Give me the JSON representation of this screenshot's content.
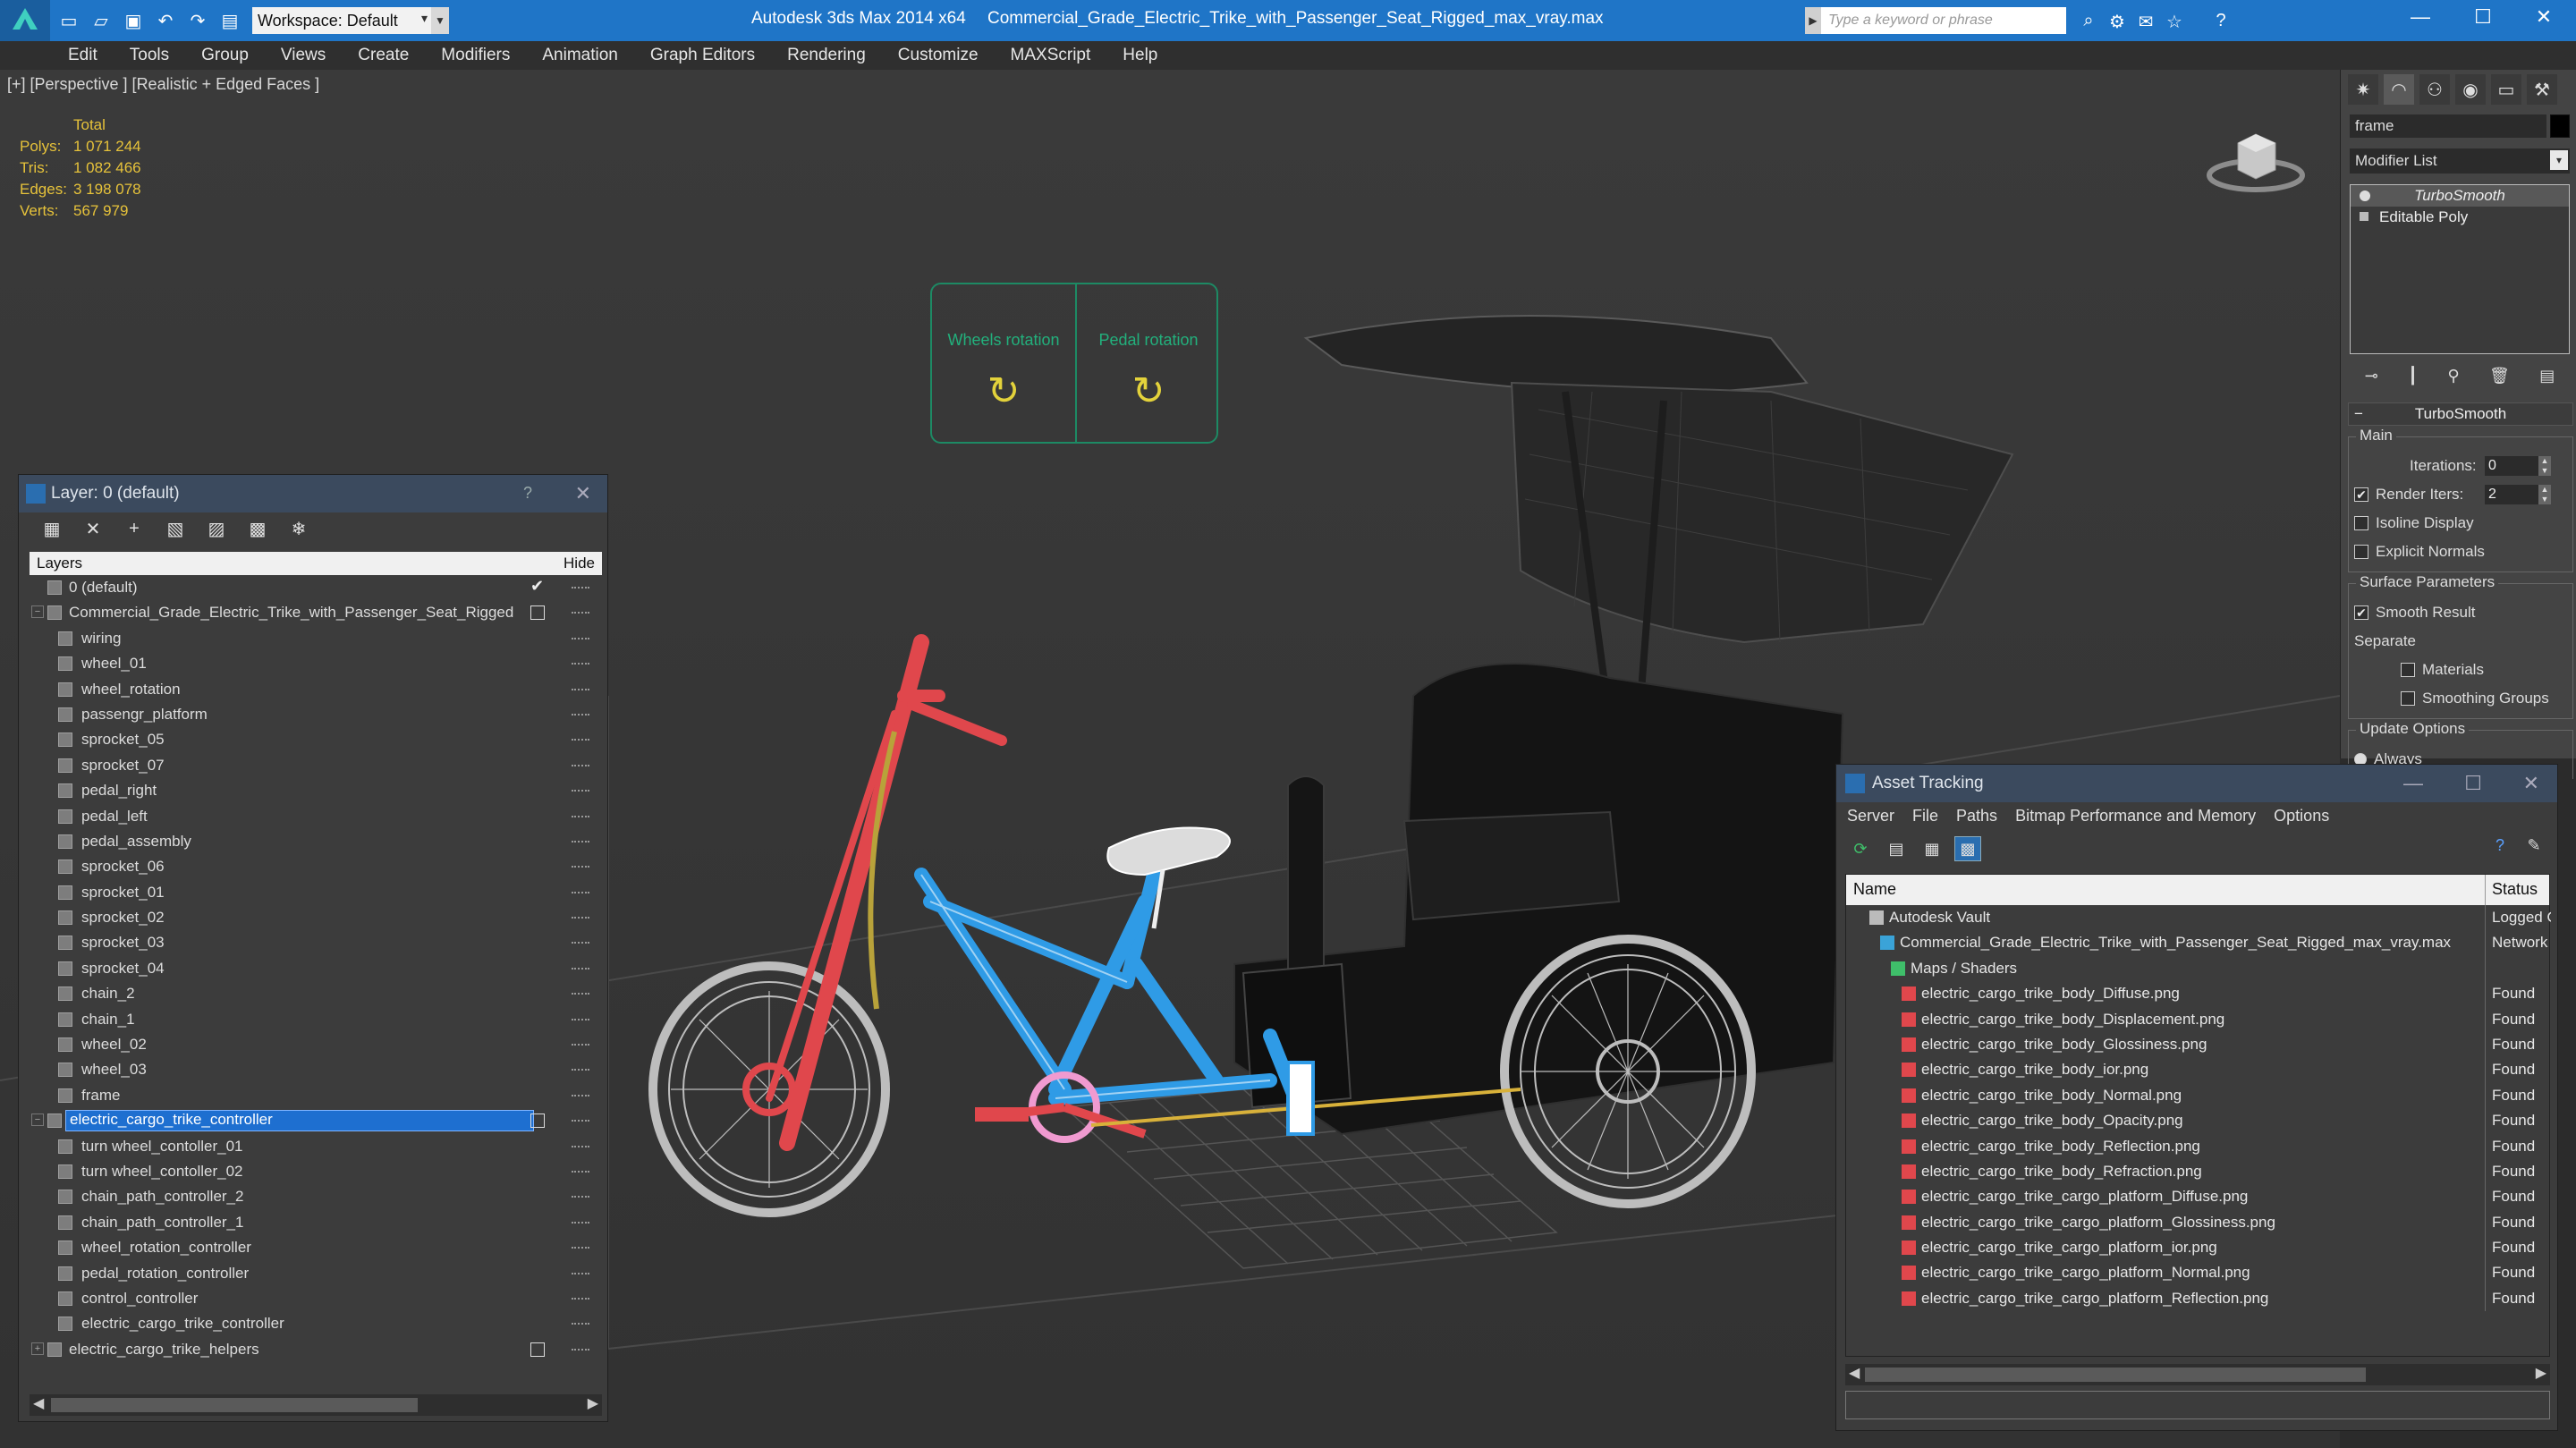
{
  "titlebar": {
    "workspace_label": "Workspace: Default",
    "app_title": "Autodesk 3ds Max  2014 x64",
    "file_title": "Commercial_Grade_Electric_Trike_with_Passenger_Seat_Rigged_max_vray.max",
    "search_placeholder": "Type a keyword or phrase"
  },
  "menubar": [
    "Edit",
    "Tools",
    "Group",
    "Views",
    "Create",
    "Modifiers",
    "Animation",
    "Graph Editors",
    "Rendering",
    "Customize",
    "MAXScript",
    "Help"
  ],
  "viewport": {
    "label": "[+] [Perspective ] [Realistic + Edged Faces ]",
    "stats": {
      "header": "Total",
      "rows": [
        {
          "key": "Polys:",
          "value": "1 071 244"
        },
        {
          "key": "Tris:",
          "value": "1 082 466"
        },
        {
          "key": "Edges:",
          "value": "3 198 078"
        },
        {
          "key": "Verts:",
          "value": "567 979"
        }
      ]
    },
    "rotation_panel": {
      "wheels_label": "Wheels rotation",
      "pedal_label": "Pedal rotation"
    }
  },
  "layer_panel": {
    "title": "Layer: 0 (default)",
    "help": "?",
    "header_layers": "Layers",
    "header_hide": "Hide",
    "rows": [
      {
        "name": "0 (default)",
        "level": 0,
        "type": "layer",
        "current": true
      },
      {
        "name": "Commercial_Grade_Electric_Trike_with_Passenger_Seat_Rigged",
        "level": 0,
        "type": "layer",
        "expand": "−",
        "box": true
      },
      {
        "name": "wiring",
        "level": 1,
        "type": "object"
      },
      {
        "name": "wheel_01",
        "level": 1,
        "type": "object"
      },
      {
        "name": "wheel_rotation",
        "level": 1,
        "type": "object"
      },
      {
        "name": "passengr_platform",
        "level": 1,
        "type": "object"
      },
      {
        "name": "sprocket_05",
        "level": 1,
        "type": "object"
      },
      {
        "name": "sprocket_07",
        "level": 1,
        "type": "object"
      },
      {
        "name": "pedal_right",
        "level": 1,
        "type": "object"
      },
      {
        "name": "pedal_left",
        "level": 1,
        "type": "object"
      },
      {
        "name": "pedal_assembly",
        "level": 1,
        "type": "object"
      },
      {
        "name": "sprocket_06",
        "level": 1,
        "type": "object"
      },
      {
        "name": "sprocket_01",
        "level": 1,
        "type": "object"
      },
      {
        "name": "sprocket_02",
        "level": 1,
        "type": "object"
      },
      {
        "name": "sprocket_03",
        "level": 1,
        "type": "object"
      },
      {
        "name": "sprocket_04",
        "level": 1,
        "type": "object"
      },
      {
        "name": "chain_2",
        "level": 1,
        "type": "object"
      },
      {
        "name": "chain_1",
        "level": 1,
        "type": "object"
      },
      {
        "name": "wheel_02",
        "level": 1,
        "type": "object"
      },
      {
        "name": "wheel_03",
        "level": 1,
        "type": "object"
      },
      {
        "name": "frame",
        "level": 1,
        "type": "object"
      },
      {
        "name": "electric_cargo_trike_controller",
        "level": 0,
        "type": "layer",
        "expand": "−",
        "box": true,
        "selected": true
      },
      {
        "name": "turn wheel_contoller_01",
        "level": 1,
        "type": "object"
      },
      {
        "name": "turn wheel_contoller_02",
        "level": 1,
        "type": "object"
      },
      {
        "name": "chain_path_controller_2",
        "level": 1,
        "type": "object"
      },
      {
        "name": "chain_path_controller_1",
        "level": 1,
        "type": "object"
      },
      {
        "name": "wheel_rotation_controller",
        "level": 1,
        "type": "object"
      },
      {
        "name": "pedal_rotation_controller",
        "level": 1,
        "type": "object"
      },
      {
        "name": "control_controller",
        "level": 1,
        "type": "object"
      },
      {
        "name": "electric_cargo_trike_controller",
        "level": 1,
        "type": "object"
      },
      {
        "name": "electric_cargo_trike_helpers",
        "level": 0,
        "type": "layer",
        "expand": "+",
        "box": true
      }
    ]
  },
  "command_panel": {
    "object_name": "frame",
    "modifier_list": "Modifier List",
    "stack": [
      "TurboSmooth",
      "Editable Poly"
    ],
    "turbosmooth": {
      "title": "TurboSmooth",
      "main_label": "Main",
      "iterations_label": "Iterations:",
      "iterations_value": "0",
      "render_iters_label": "Render Iters:",
      "render_iters_value": "2",
      "isoline_label": "Isoline Display",
      "explicit_label": "Explicit Normals",
      "surface_label": "Surface Parameters",
      "smooth_result_label": "Smooth Result",
      "separate_label": "Separate",
      "materials_label": "Materials",
      "smoothing_groups_label": "Smoothing Groups",
      "update_label": "Update Options",
      "always_label": "Always"
    }
  },
  "asset_panel": {
    "title": "Asset Tracking",
    "menu": [
      "Server",
      "File",
      "Paths",
      "Bitmap Performance and Memory",
      "Options"
    ],
    "header_name": "Name",
    "header_status": "Status",
    "rows": [
      {
        "name": "Autodesk Vault",
        "status": "Logged O",
        "level": 1,
        "icon": "vault"
      },
      {
        "name": "Commercial_Grade_Electric_Trike_with_Passenger_Seat_Rigged_max_vray.max",
        "status": "Network I",
        "level": 2,
        "icon": "max"
      },
      {
        "name": "Maps / Shaders",
        "status": "",
        "level": 3,
        "icon": "maps"
      },
      {
        "name": "electric_cargo_trike_body_Diffuse.png",
        "status": "Found",
        "level": 4,
        "icon": "png"
      },
      {
        "name": "electric_cargo_trike_body_Displacement.png",
        "status": "Found",
        "level": 4,
        "icon": "png"
      },
      {
        "name": "electric_cargo_trike_body_Glossiness.png",
        "status": "Found",
        "level": 4,
        "icon": "png"
      },
      {
        "name": "electric_cargo_trike_body_ior.png",
        "status": "Found",
        "level": 4,
        "icon": "png"
      },
      {
        "name": "electric_cargo_trike_body_Normal.png",
        "status": "Found",
        "level": 4,
        "icon": "png"
      },
      {
        "name": "electric_cargo_trike_body_Opacity.png",
        "status": "Found",
        "level": 4,
        "icon": "png"
      },
      {
        "name": "electric_cargo_trike_body_Reflection.png",
        "status": "Found",
        "level": 4,
        "icon": "png"
      },
      {
        "name": "electric_cargo_trike_body_Refraction.png",
        "status": "Found",
        "level": 4,
        "icon": "png"
      },
      {
        "name": "electric_cargo_trike_cargo_platform_Diffuse.png",
        "status": "Found",
        "level": 4,
        "icon": "png"
      },
      {
        "name": "electric_cargo_trike_cargo_platform_Glossiness.png",
        "status": "Found",
        "level": 4,
        "icon": "png"
      },
      {
        "name": "electric_cargo_trike_cargo_platform_ior.png",
        "status": "Found",
        "level": 4,
        "icon": "png"
      },
      {
        "name": "electric_cargo_trike_cargo_platform_Normal.png",
        "status": "Found",
        "level": 4,
        "icon": "png"
      },
      {
        "name": "electric_cargo_trike_cargo_platform_Reflection.png",
        "status": "Found",
        "level": 4,
        "icon": "png"
      }
    ]
  },
  "colors": {
    "titlebar": "#1f75c7",
    "selection": "#1e6fd0",
    "stats_text": "#e6c23a",
    "rotation_label": "#22b07c",
    "trike_frame": "#2f9be6",
    "trike_red": "#e0474c"
  }
}
